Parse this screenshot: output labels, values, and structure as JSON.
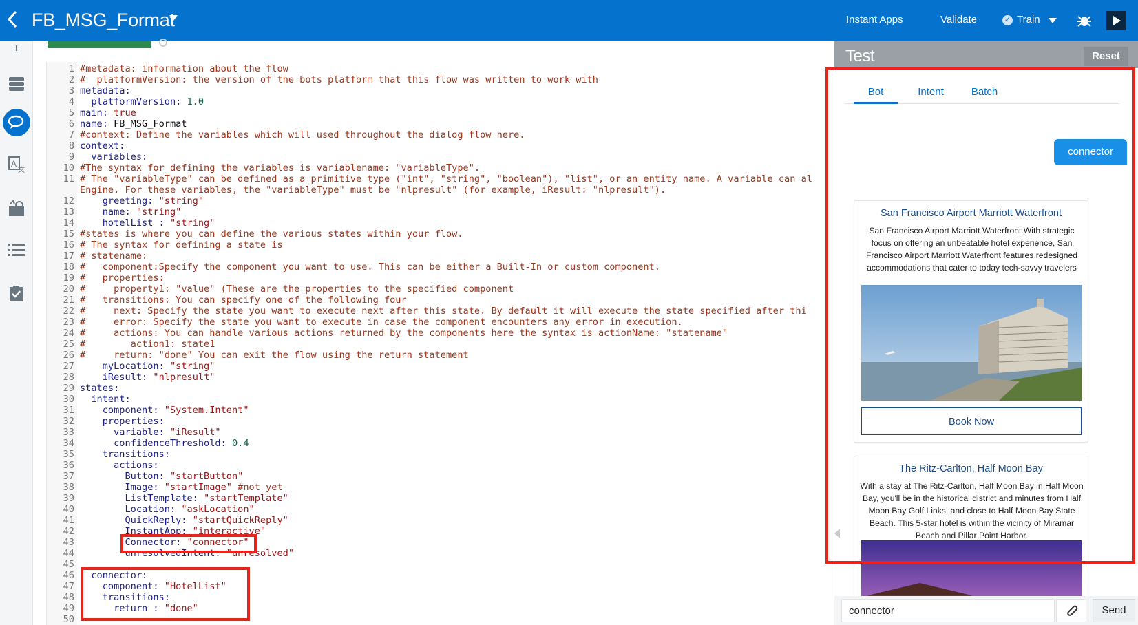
{
  "header": {
    "back_icon": "chevron-left-icon",
    "title": "FB_MSG_Format",
    "links": {
      "instant_apps": "Instant Apps",
      "validate": "Validate",
      "train": "Train"
    },
    "accent": "#0572ce"
  },
  "editor": {
    "lines": [
      {
        "n": "1",
        "segs": [
          {
            "t": "#metadata: information about the flow",
            "c": "c-comment"
          }
        ]
      },
      {
        "n": "2",
        "segs": [
          {
            "t": "#  platformVersion: the version of the bots platform that this flow was written to work with",
            "c": "c-comment"
          }
        ]
      },
      {
        "n": "3",
        "segs": [
          {
            "t": "metadata:",
            "c": "c-key"
          }
        ]
      },
      {
        "n": "4",
        "segs": [
          {
            "t": "  platformVersion: ",
            "c": "c-key"
          },
          {
            "t": "1.0",
            "c": "c-num"
          }
        ]
      },
      {
        "n": "5",
        "segs": [
          {
            "t": "main: ",
            "c": "c-key"
          },
          {
            "t": "true",
            "c": "c-str"
          }
        ]
      },
      {
        "n": "6",
        "segs": [
          {
            "t": "name: ",
            "c": "c-key"
          },
          {
            "t": "FB_MSG_Format",
            "c": "c-plain"
          }
        ]
      },
      {
        "n": "7",
        "segs": [
          {
            "t": "#context: Define the variables which will used throughout the dialog flow here.",
            "c": "c-comment"
          }
        ]
      },
      {
        "n": "8",
        "segs": [
          {
            "t": "context:",
            "c": "c-key"
          }
        ]
      },
      {
        "n": "9",
        "segs": [
          {
            "t": "  variables:",
            "c": "c-key"
          }
        ]
      },
      {
        "n": "10",
        "segs": [
          {
            "t": "#The syntax for defining the variables is variablename: \"variableType\".",
            "c": "c-comment"
          }
        ]
      },
      {
        "n": "11",
        "segs": [
          {
            "t": "# The \"variableType\" can be defined as a primitive type (\"int\", \"string\", \"boolean\"), \"list\", or an entity name. A variable can al",
            "c": "c-comment"
          }
        ]
      },
      {
        "n": "",
        "segs": [
          {
            "t": "Engine. For these variables, the \"variableType\" must be \"nlpresult\" (for example, iResult: \"nlpresult\").",
            "c": "c-comment"
          }
        ]
      },
      {
        "n": "12",
        "segs": [
          {
            "t": "    greeting: ",
            "c": "c-key"
          },
          {
            "t": "\"string\"",
            "c": "c-str"
          }
        ]
      },
      {
        "n": "13",
        "segs": [
          {
            "t": "    name: ",
            "c": "c-key"
          },
          {
            "t": "\"string\"",
            "c": "c-str"
          }
        ]
      },
      {
        "n": "14",
        "segs": [
          {
            "t": "    hotelList : ",
            "c": "c-key"
          },
          {
            "t": "\"string\"",
            "c": "c-str"
          }
        ]
      },
      {
        "n": "15",
        "segs": [
          {
            "t": "#states is where you can define the various states within your flow.",
            "c": "c-comment"
          }
        ]
      },
      {
        "n": "16",
        "segs": [
          {
            "t": "# The syntax for defining a state is",
            "c": "c-comment"
          }
        ]
      },
      {
        "n": "17",
        "segs": [
          {
            "t": "# statename:",
            "c": "c-comment"
          }
        ]
      },
      {
        "n": "18",
        "segs": [
          {
            "t": "#   component:Specify the component you want to use. This can be either a Built-In or custom component.",
            "c": "c-comment"
          }
        ]
      },
      {
        "n": "19",
        "segs": [
          {
            "t": "#   properties:",
            "c": "c-comment"
          }
        ]
      },
      {
        "n": "20",
        "segs": [
          {
            "t": "#     property1: \"value\" (These are the properties to the specified component",
            "c": "c-comment"
          }
        ]
      },
      {
        "n": "21",
        "segs": [
          {
            "t": "#   transitions: You can specify one of the following four",
            "c": "c-comment"
          }
        ]
      },
      {
        "n": "22",
        "segs": [
          {
            "t": "#     next: Specify the state you want to execute next after this state. By default it will execute the state specified after thi",
            "c": "c-comment"
          }
        ]
      },
      {
        "n": "23",
        "segs": [
          {
            "t": "#     error: Specify the state you want to execute in case the component encounters any error in execution.",
            "c": "c-comment"
          }
        ]
      },
      {
        "n": "24",
        "segs": [
          {
            "t": "#     actions: You can handle various actions returned by the components here the syntax is actionName: \"statename\"",
            "c": "c-comment"
          }
        ]
      },
      {
        "n": "25",
        "segs": [
          {
            "t": "#        action1: state1",
            "c": "c-comment"
          }
        ]
      },
      {
        "n": "26",
        "segs": [
          {
            "t": "#     return: \"done\" You can exit the flow using the return statement",
            "c": "c-comment"
          }
        ]
      },
      {
        "n": "27",
        "segs": [
          {
            "t": "    myLocation: ",
            "c": "c-key"
          },
          {
            "t": "\"string\"",
            "c": "c-str"
          }
        ]
      },
      {
        "n": "28",
        "segs": [
          {
            "t": "    iResult: ",
            "c": "c-key"
          },
          {
            "t": "\"nlpresult\"",
            "c": "c-str"
          }
        ]
      },
      {
        "n": "29",
        "segs": [
          {
            "t": "states:",
            "c": "c-key"
          }
        ]
      },
      {
        "n": "30",
        "segs": [
          {
            "t": "  intent:",
            "c": "c-key"
          }
        ]
      },
      {
        "n": "31",
        "segs": [
          {
            "t": "    component: ",
            "c": "c-key"
          },
          {
            "t": "\"System.Intent\"",
            "c": "c-str"
          }
        ]
      },
      {
        "n": "32",
        "segs": [
          {
            "t": "    properties:",
            "c": "c-key"
          }
        ]
      },
      {
        "n": "33",
        "segs": [
          {
            "t": "      variable: ",
            "c": "c-key"
          },
          {
            "t": "\"iResult\"",
            "c": "c-str"
          }
        ]
      },
      {
        "n": "34",
        "segs": [
          {
            "t": "      confidenceThreshold: ",
            "c": "c-key"
          },
          {
            "t": "0.4",
            "c": "c-num"
          }
        ]
      },
      {
        "n": "35",
        "segs": [
          {
            "t": "    transitions:",
            "c": "c-key"
          }
        ]
      },
      {
        "n": "36",
        "segs": [
          {
            "t": "      actions:",
            "c": "c-key"
          }
        ]
      },
      {
        "n": "37",
        "segs": [
          {
            "t": "        Button: ",
            "c": "c-key"
          },
          {
            "t": "\"startButton\"",
            "c": "c-str"
          }
        ]
      },
      {
        "n": "38",
        "segs": [
          {
            "t": "        Image: ",
            "c": "c-key"
          },
          {
            "t": "\"startImage\"",
            "c": "c-str"
          },
          {
            "t": " #not yet",
            "c": "c-comment"
          }
        ]
      },
      {
        "n": "39",
        "segs": [
          {
            "t": "        ListTemplate: ",
            "c": "c-key"
          },
          {
            "t": "\"startTemplate\"",
            "c": "c-str"
          }
        ]
      },
      {
        "n": "40",
        "segs": [
          {
            "t": "        Location: ",
            "c": "c-key"
          },
          {
            "t": "\"askLocation\"",
            "c": "c-str"
          }
        ]
      },
      {
        "n": "41",
        "segs": [
          {
            "t": "        QuickReply: ",
            "c": "c-key"
          },
          {
            "t": "\"startQuickReply\"",
            "c": "c-str"
          }
        ]
      },
      {
        "n": "42",
        "segs": [
          {
            "t": "        InstantApp: ",
            "c": "c-key"
          },
          {
            "t": "\"interactive\"",
            "c": "c-str"
          }
        ]
      },
      {
        "n": "43",
        "segs": [
          {
            "t": "        Connector: ",
            "c": "c-key"
          },
          {
            "t": "\"connector\"",
            "c": "c-str"
          }
        ]
      },
      {
        "n": "44",
        "segs": [
          {
            "t": "        unresolvedIntent: ",
            "c": "c-key"
          },
          {
            "t": "\"unresolved\"",
            "c": "c-str"
          }
        ]
      },
      {
        "n": "45",
        "segs": []
      },
      {
        "n": "46",
        "segs": [
          {
            "t": "  connector:",
            "c": "c-key"
          }
        ]
      },
      {
        "n": "47",
        "segs": [
          {
            "t": "    component: ",
            "c": "c-key"
          },
          {
            "t": "\"HotelList\"",
            "c": "c-str"
          }
        ]
      },
      {
        "n": "48",
        "segs": [
          {
            "t": "    transitions:",
            "c": "c-key"
          }
        ]
      },
      {
        "n": "49",
        "segs": [
          {
            "t": "      return : ",
            "c": "c-key"
          },
          {
            "t": "\"done\"",
            "c": "c-str"
          }
        ]
      },
      {
        "n": "50",
        "segs": []
      }
    ]
  },
  "test_panel": {
    "title": "Test",
    "reset_label": "Reset",
    "tabs": [
      "Bot",
      "Intent",
      "Batch"
    ],
    "active_tab": "Bot",
    "user_message": "connector",
    "cards": [
      {
        "title": "San Francisco Airport Marriott Waterfront",
        "description": "San Francisco Airport Marriott Waterfront.With strategic focus on offering an unbeatable hotel experience, San Francisco Airport Marriott Waterfront features redesigned accommodations that cater to today tech-savvy travelers",
        "button": "Book Now"
      },
      {
        "title": "The Ritz-Carlton, Half Moon Bay",
        "description": "With a stay at The Ritz-Carlton, Half Moon Bay in Half Moon Bay, you'll be in the historical district and minutes from Half Moon Bay Golf Links, and close to Half Moon Bay State Beach. This 5-star hotel is within the vicinity of Miramar Beach and Pillar Point Harbor."
      }
    ],
    "input_value": "connector",
    "send_label": "Send"
  },
  "colors": {
    "highlight": "#e8231c",
    "link": "#1d4e8c",
    "bubble": "#1a8fe8"
  }
}
